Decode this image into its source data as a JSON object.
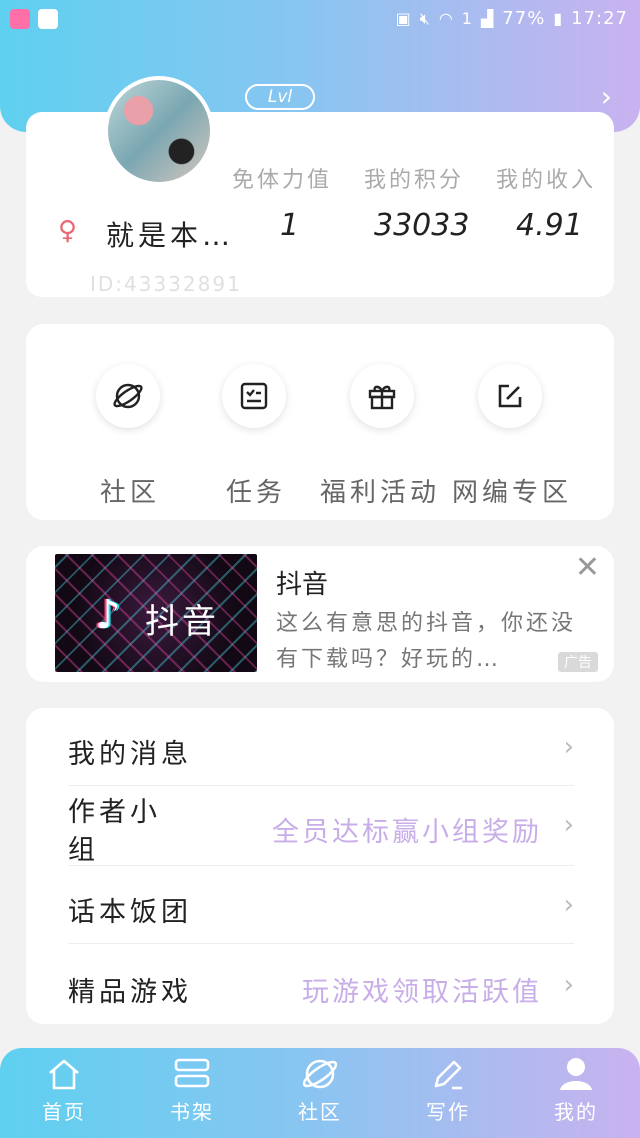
{
  "status_bar": {
    "battery": "77%",
    "time": "17:27",
    "sim": "1",
    "icons": [
      "app-icon-pink",
      "gallery-icon",
      "nfc-icon",
      "mute-icon",
      "wifi-icon",
      "sim-icon",
      "signal-icon",
      "battery-icon"
    ]
  },
  "header": {
    "level_badge": "Lvl",
    "chevron": "›"
  },
  "profile": {
    "gender_icon": "female-symbol-icon",
    "username": "就是本…",
    "user_id": "ID:43332891",
    "stats": [
      {
        "label": "免体力值",
        "value": "1"
      },
      {
        "label": "我的积分",
        "value": "33033"
      },
      {
        "label": "我的收入",
        "value": "4.91"
      }
    ]
  },
  "quick_actions": [
    {
      "label": "社区",
      "icon": "planet-icon"
    },
    {
      "label": "任务",
      "icon": "checklist-icon"
    },
    {
      "label": "福利活动",
      "icon": "gift-icon"
    },
    {
      "label": "网编专区",
      "icon": "edit-icon"
    }
  ],
  "ad": {
    "title": "抖音",
    "description": "这么有意思的抖音，你还没有下载吗？好玩的…",
    "logo_text": "抖音",
    "tag": "广告",
    "close": "✕"
  },
  "menu": [
    {
      "label": "我的消息",
      "promo": ""
    },
    {
      "label": "作者小组",
      "promo": "全员达标赢小组奖励"
    },
    {
      "label": "话本饭团",
      "promo": ""
    },
    {
      "label": "精品游戏",
      "promo": "玩游戏领取活跃值"
    }
  ],
  "menu_chevron": "›",
  "tabbar": [
    {
      "label": "首页",
      "icon": "home-icon"
    },
    {
      "label": "书架",
      "icon": "bookshelf-icon"
    },
    {
      "label": "社区",
      "icon": "planet-icon"
    },
    {
      "label": "写作",
      "icon": "pen-icon"
    },
    {
      "label": "我的",
      "icon": "profile-icon"
    }
  ],
  "colors": {
    "gradient_start": "#5fd0f0",
    "gradient_end": "#c9b2ef",
    "promo_text": "#c8aee8",
    "gender_icon": "#e86a75"
  }
}
